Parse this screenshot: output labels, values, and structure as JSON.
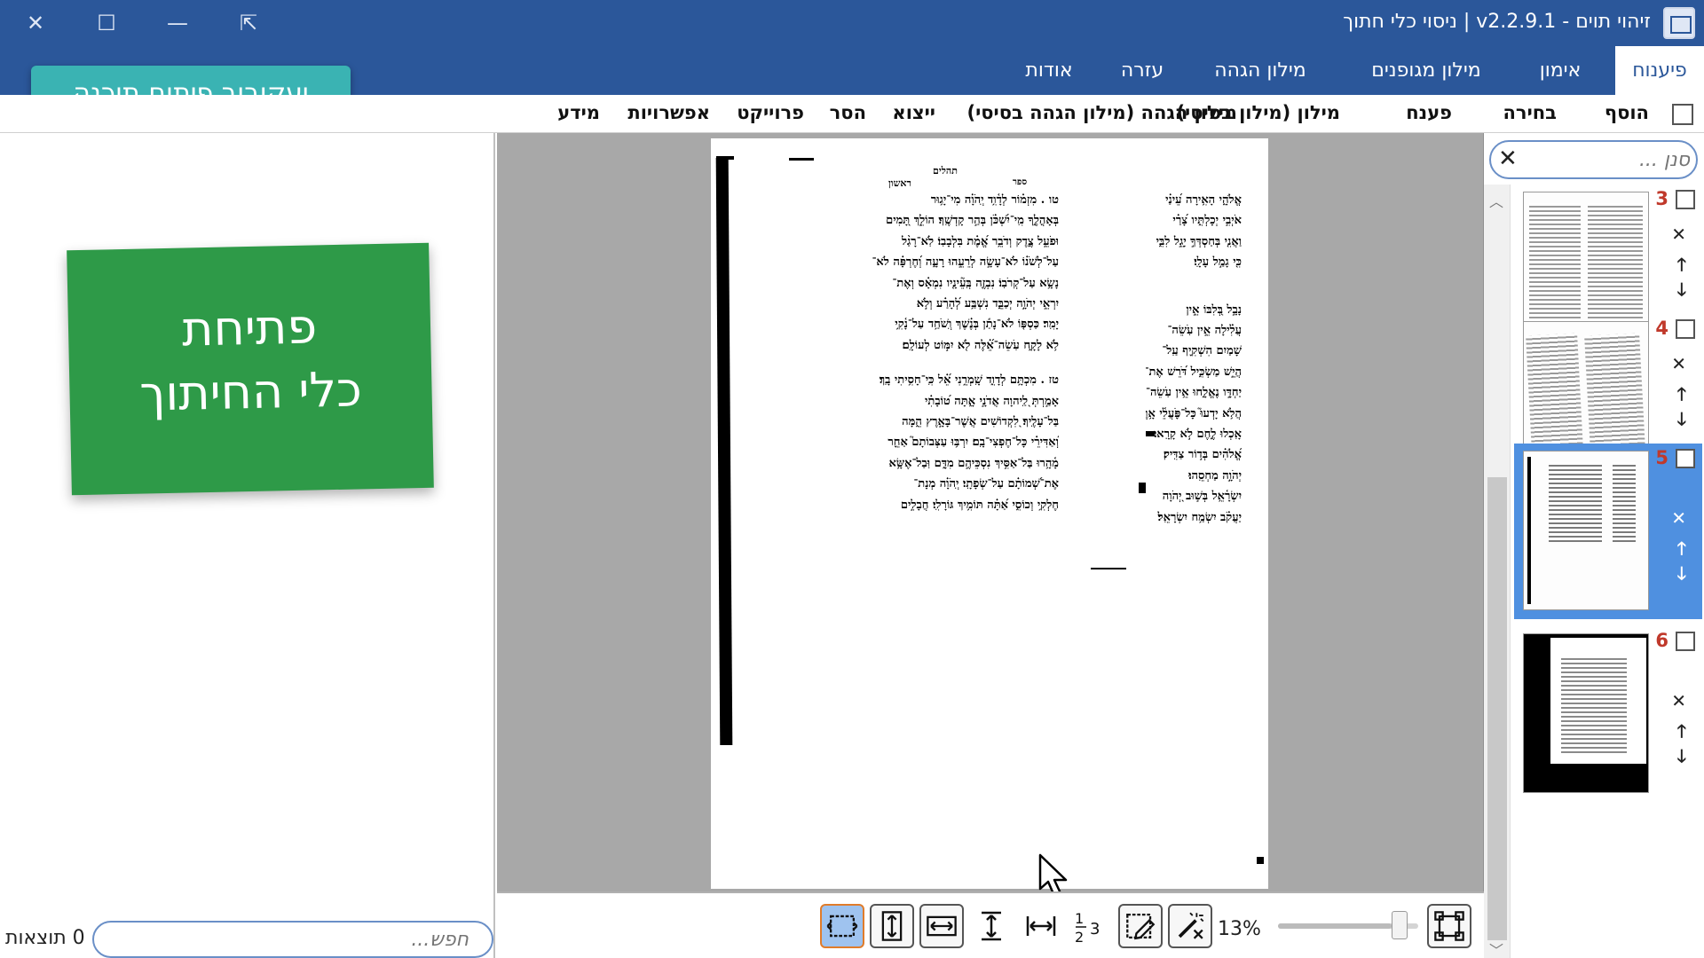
{
  "window": {
    "title": "זיהוי תוים - v2.2.9.1 | ניסוי כלי חתוך",
    "controls": {
      "close": "✕",
      "maximize": "☐",
      "minimize": "—",
      "restore": "⇱"
    }
  },
  "ribbon_tabs": [
    {
      "label": "פיענוח",
      "active": true
    },
    {
      "label": "אימון",
      "active": false
    },
    {
      "label": "מילון מגופנים",
      "active": false
    },
    {
      "label": "מילון הגהה",
      "active": false
    },
    {
      "label": "עזרה",
      "active": false
    },
    {
      "label": "אודות",
      "active": false
    }
  ],
  "promo_label": "יעקובוב פיתוח תוכנה",
  "toolbar": {
    "items": [
      "הוסף",
      "בחירה",
      "פענח",
      "מילון (מילון בסיסי)",
      "מילון הגהה (מילון הגהה בסיסי)",
      "ייצוא",
      "הסר",
      "פרוייקט",
      "אפשרויות",
      "מידע"
    ]
  },
  "left_panel": {
    "card_line1": "פתיחת",
    "card_line2": "כלי החיתוך",
    "search_placeholder": "חפש...",
    "results_text": "0 תוצאות"
  },
  "viewer": {
    "page_header": "תהלים",
    "page_header_right": "ספר",
    "page_header_first": "ראשון",
    "col_left_lines": [
      "טו . מִזְמ֗וֹר לְדָ֫וִ֥ד יְֽהֹוָ֗ה מִי־יָג֥וּר",
      "בְּאָהֳלֶ֑ךָ מִֽי־יִ֝שְׁכֹּ֗ן בְּהַ֣ר קָדְשֶֽׁךָ׃ הוֹלֵ֣ךְ תָּ֭מִים",
      "וּפֹעֵ֣ל צֶ֑דֶק וְדֹבֵ֥ר אֱ֝מֶ֗ת בִּלְבָבֽוֹ׃ לֹֽא־רָגַ֨ל",
      "עַל־לְשֹׁנ֗וֹ לֹא־עָשָׂ֣ה לְרֵעֵ֣הוּ רָעָ֑ה וְ֝חֶרְפָּ֗ה לֹא־",
      "נָשָׂ֥א עַל־קְרֹבֽוֹ׃ נִבְזֶ֤ה בְּֽעֵ֘ינָ֤יו נִמְאָ֗ס וְאֶת־",
      "יִרְאֵ֣י יְהֹוָ֣ה יְכַבֵּ֑ד נִשְׁבַּ֥ע לְ֝הָרַ֗ע וְלֹ֣א",
      "יָמִֽר׃ כַּסְפּ֤וֹ לֹא־נָתַ֬ן בְּנֶ֗שֶׁךְ וְֽשֹׁחַ֥ד עַל־נָ֫קִ֥י",
      "לֹ֥א לָקָ֑ח עֹֽשֵׂה־אֵ֝֗לֶּה לֹ֖א יִמּ֣וֹט לְעוֹלָֽם׃",
      "טז . מִכְתָּ֥ם לְדָוִ֑ד שָֽׁמְרֵ֥נִי אֵ֝֗ל כִּֽי־חָסִ֥יתִי בָֽךְ׃",
      "אָמַ֣רְתְּ לַֽ֭יהוָה אֲדֹנָ֣י אָ֑תָּה ט֝וֹבָתִ֗י",
      "בַּל־עָלֶֽיךָ׃ לִ֭קְדוֹשִׁים אֲשֶׁר־בָּאָ֣רֶץ הֵ֑מָּה",
      "וְ֝אַדִּירֵ֗י כָּל־חֶפְצִי־בָֽם׃ יִרְבּ֥וּ עַצְּבוֹתָם֮ אַחֵ֪ר",
      "מָ֫הָ֥רוּ בַּל־אַסִּ֣יךְ נִסְכֵּיהֶ֣ם מִדָּ֑ם וּֽבַל־אֶשָּׂ֥א",
      "אֶת־שְׁ֝מוֹתָ֗ם עַל־שְׂפָתָֽי׃ יְֽהֹוָ֗ה מְנָת־",
      "חֶלְקִ֥י וְכוֹסִ֑י אַ֝תָּ֗ה תּוֹמִ֥יךְ גּוֹרָלִֽי׃ חֲבָלִ֣ים"
    ],
    "col_right_lines": [
      "אֱלֹהָ֑י הָאִ֥ירָה עֵ֝ינַ֗י",
      "אֹיְבִ֣י יְכָלְתִּ֑יו צָ֝רַ֗י",
      "וַאֲנִ֤י בְּחַסְדְּךָ֣ יָגֵ֣ל לִבִּ֑י",
      "כִּ֖י גָמַ֣ל עָלָֽי׃",
      "נָבָ֣ל בְּ֭לִבּוֹ אֵ֣ין",
      "עֲלִ֗ילָה אֵ֣ין עֹֽשֵׂה־",
      "שָׁמַיִם הִשְׁקִ֪יף עַֽל־",
      "הֲיֵ֣שׁ מַשְׂכִּ֑יל דֹּ֝רֵשׁ אֶת־",
      "יַחְדָּ֣ו נֶאֱלָ֑חוּ אֵ֥ין עֹֽשֵׂה־",
      "הֲלֹ֥א יָדְעוּ֮ כָּל־פֹּ֪עֲלֵ֫י אָ֥וֶן",
      "אָֽכְלוּ לֶ֑חֶם לֹ֣א קָרָֽאוּ׃",
      "אֱ֝לֹהִ֗ים בְּד֣וֹר צַדִּֽיק׃",
      "יְהֹוָ֣ה מַחְסֵֽהוּ׃",
      "יִשְׂרָ֫אֵ֥ל בְּשׁ֣וּב יְ֭הֹוָה",
      "יַעֲקֹ֗ב יִשְׂמַ֥ח יִשְׂרָאֵֽל׃"
    ]
  },
  "bottom_controls": {
    "zoom_label": "13%",
    "zoom_value": 0.13
  },
  "right_panel": {
    "filter_placeholder": "סנן ...",
    "filter_clear": "✕",
    "thumbnails": [
      {
        "num": "3",
        "selected": false
      },
      {
        "num": "4",
        "selected": false
      },
      {
        "num": "5",
        "selected": true
      },
      {
        "num": "6",
        "selected": false
      }
    ],
    "btn_remove": "✕",
    "btn_up": "🡑",
    "btn_down": "🡓"
  }
}
